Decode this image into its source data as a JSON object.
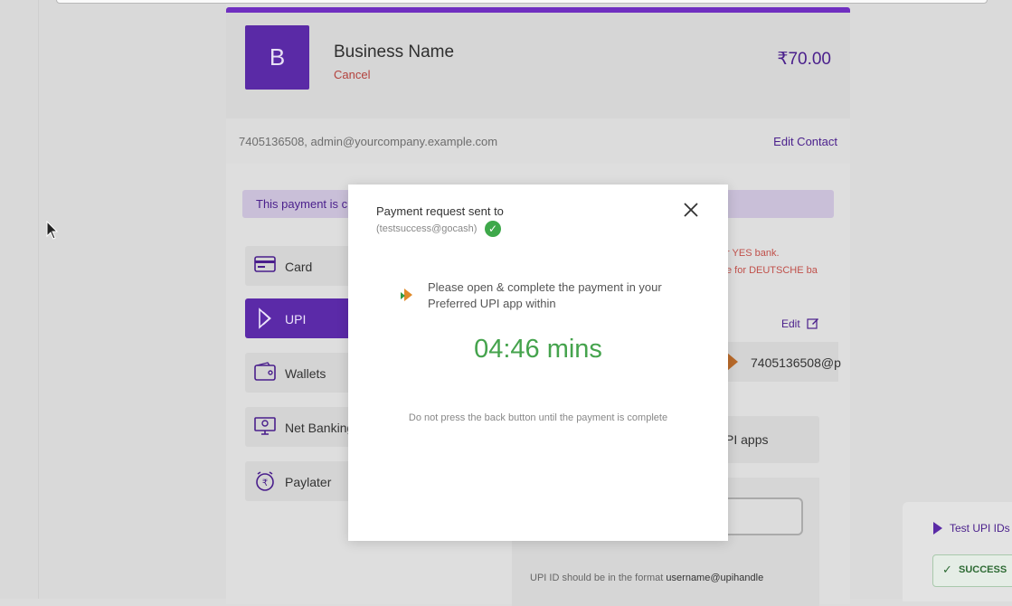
{
  "header": {
    "logo_letter": "B",
    "business_name": "Business Name",
    "cancel_label": "Cancel",
    "amount": "₹70.00"
  },
  "contact": {
    "details": "7405136508, admin@yourcompany.example.com",
    "edit_label": "Edit Contact"
  },
  "notice": {
    "text": "This payment is c"
  },
  "methods": [
    {
      "label": "Card",
      "icon": "card-icon"
    },
    {
      "label": "UPI",
      "icon": "upi-icon",
      "active": true
    },
    {
      "label": "Wallets",
      "icon": "wallet-icon"
    },
    {
      "label": "Net Banking",
      "icon": "bank-icon"
    },
    {
      "label": "Paylater",
      "icon": "paylater-icon"
    }
  ],
  "bank_notes": [
    "r YES bank.",
    "e for DEUTSCHE ba"
  ],
  "upi": {
    "edit_label": "Edit",
    "saved_id": "7405136508@p",
    "apps_label": "PI apps",
    "format_hint": "UPI ID should be in the format",
    "format_example": "username@upihandle"
  },
  "test_panel": {
    "title": "Test UPI IDs",
    "success_label": "SUCCESS"
  },
  "modal": {
    "title": "Payment request sent to",
    "vpa": "(testsuccess@gocash)",
    "message": "Please open & complete the payment in your Preferred UPI app within",
    "timer": "04:46 mins",
    "note": "Do not press the back button until the payment is complete"
  },
  "colors": {
    "brand": "#5b2aa8",
    "timer": "#45a34d",
    "cancel": "#b3423d"
  }
}
